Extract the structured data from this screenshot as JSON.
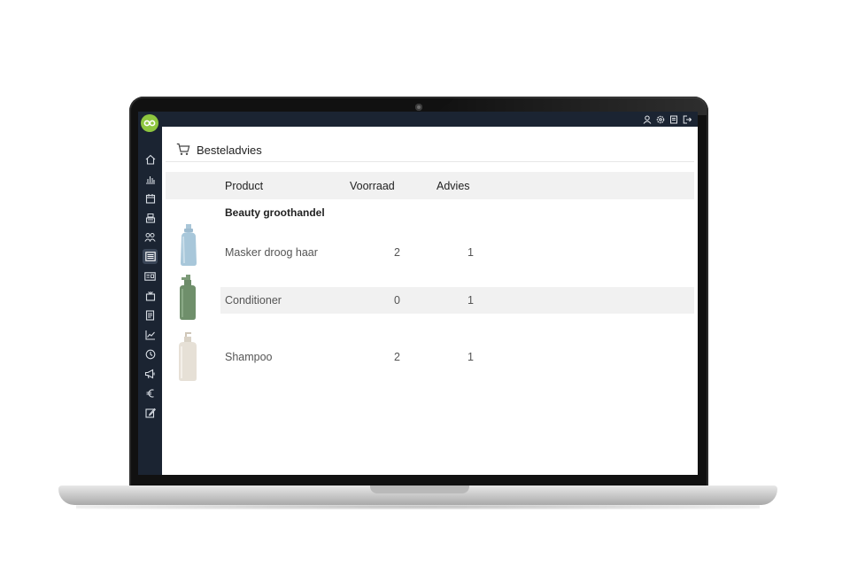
{
  "app": {
    "page_title": "Besteladvies",
    "page_icon": "cart-icon",
    "accent_color": "#8ec63f",
    "sidebar_color": "#1b2432"
  },
  "sidebar": {
    "items": [
      {
        "icon": "home-icon"
      },
      {
        "icon": "bar-chart-icon"
      },
      {
        "icon": "calendar-icon"
      },
      {
        "icon": "register-icon"
      },
      {
        "icon": "users-icon"
      },
      {
        "icon": "list-icon",
        "active": true
      },
      {
        "icon": "id-card-icon"
      },
      {
        "icon": "box-icon"
      },
      {
        "icon": "document-icon"
      },
      {
        "icon": "trend-chart-icon"
      },
      {
        "icon": "clock-icon"
      },
      {
        "icon": "megaphone-icon"
      },
      {
        "icon": "euro-icon"
      },
      {
        "icon": "edit-icon"
      }
    ]
  },
  "topbar": {
    "icons": [
      "user-icon",
      "settings-icon",
      "book-icon",
      "logout-icon"
    ]
  },
  "table": {
    "headers": {
      "product": "Product",
      "stock": "Voorraad",
      "advice": "Advies"
    },
    "group": "Beauty groothandel",
    "rows": [
      {
        "name": "Masker droog haar",
        "stock": "2",
        "advice": "1",
        "image": "blue-bottle"
      },
      {
        "name": "Conditioner",
        "stock": "0",
        "advice": "1",
        "image": "green-bottle"
      },
      {
        "name": "Shampoo",
        "stock": "2",
        "advice": "1",
        "image": "white-bottle"
      }
    ]
  }
}
